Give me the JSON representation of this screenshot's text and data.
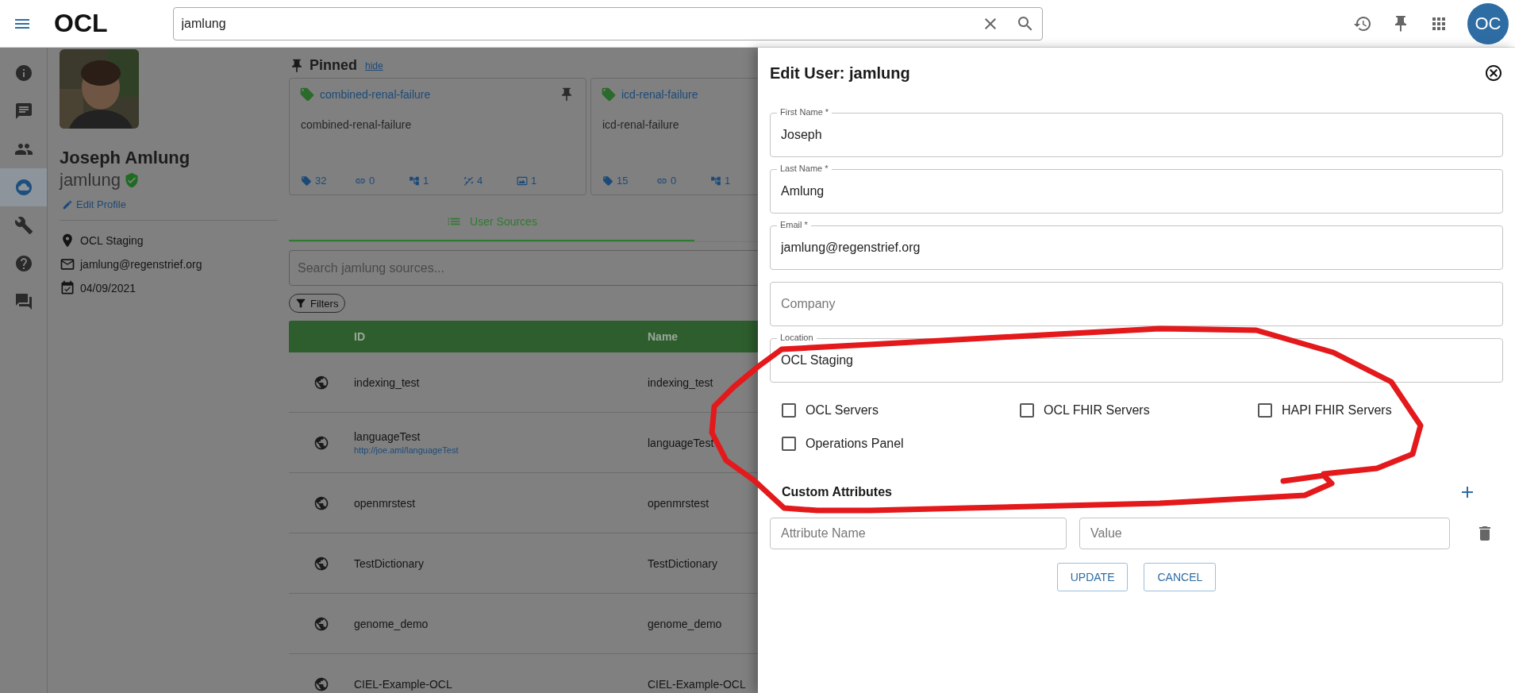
{
  "app_bar": {
    "logo": "OCL",
    "search": {
      "value": "jamlung"
    },
    "avatar": "OC"
  },
  "nav_rail": [
    {
      "selected": false
    },
    {
      "selected": false
    },
    {
      "selected": false
    },
    {
      "selected": true
    },
    {
      "selected": false
    },
    {
      "selected": false
    },
    {
      "selected": false
    }
  ],
  "profile": {
    "name": "Joseph Amlung",
    "username": "jamlung",
    "verified": true,
    "edit_link": "Edit Profile",
    "details": [
      "OCL Staging",
      "jamlung@regenstrief.org",
      "04/09/2021"
    ]
  },
  "pinned": {
    "title": "Pinned",
    "hide_link": "hide",
    "cards": [
      {
        "title": "combined-renal-failure",
        "description": "combined-renal-failure",
        "pinned": true,
        "stats": [
          "32",
          "0",
          "1",
          "4",
          "1"
        ]
      },
      {
        "title": "icd-renal-failure",
        "description": "icd-renal-failure",
        "stats": [
          "15",
          "0",
          "1"
        ]
      }
    ]
  },
  "tabs": [
    {
      "label": "User Sources",
      "selected": true
    }
  ],
  "source_search": {
    "placeholder": "Search jamlung sources..."
  },
  "filters": "Filters",
  "table": {
    "columns": [
      "ID",
      "Name"
    ],
    "rows": [
      {
        "id": "indexing_test",
        "name": "indexing_test"
      },
      {
        "id": "languageTest",
        "url": "http://joe.aml/languageTest",
        "name": "languageTest"
      },
      {
        "id": "openmrstest",
        "name": "openmrstest"
      },
      {
        "id": "TestDictionary",
        "name": "TestDictionary"
      },
      {
        "id": "genome_demo",
        "name": "genome_demo"
      },
      {
        "id": "CIEL-Example-OCL",
        "name": "CIEL-Example-OCL"
      }
    ]
  },
  "drawer": {
    "title": "Edit User: jamlung",
    "fields": [
      {
        "label": "First Name *",
        "value": "Joseph"
      },
      {
        "label": "Last Name *",
        "value": "Amlung"
      },
      {
        "label": "Email *",
        "value": "jamlung@regenstrief.org"
      },
      {
        "placeholder": "Company"
      },
      {
        "label": "Location",
        "value": "OCL Staging"
      }
    ],
    "checkboxes": [
      {
        "label": "OCL Servers",
        "checked": false
      },
      {
        "label": "OCL FHIR Servers",
        "checked": false
      },
      {
        "label": "HAPI FHIR Servers",
        "checked": false
      },
      {
        "label": "Operations Panel",
        "checked": false
      }
    ],
    "custom_attributes": {
      "title": "Custom Attributes",
      "name_field": {
        "placeholder": "Attribute Name"
      },
      "value_field": {
        "placeholder": "Value"
      }
    },
    "buttons": [
      "UPDATE",
      "CANCEL"
    ]
  }
}
